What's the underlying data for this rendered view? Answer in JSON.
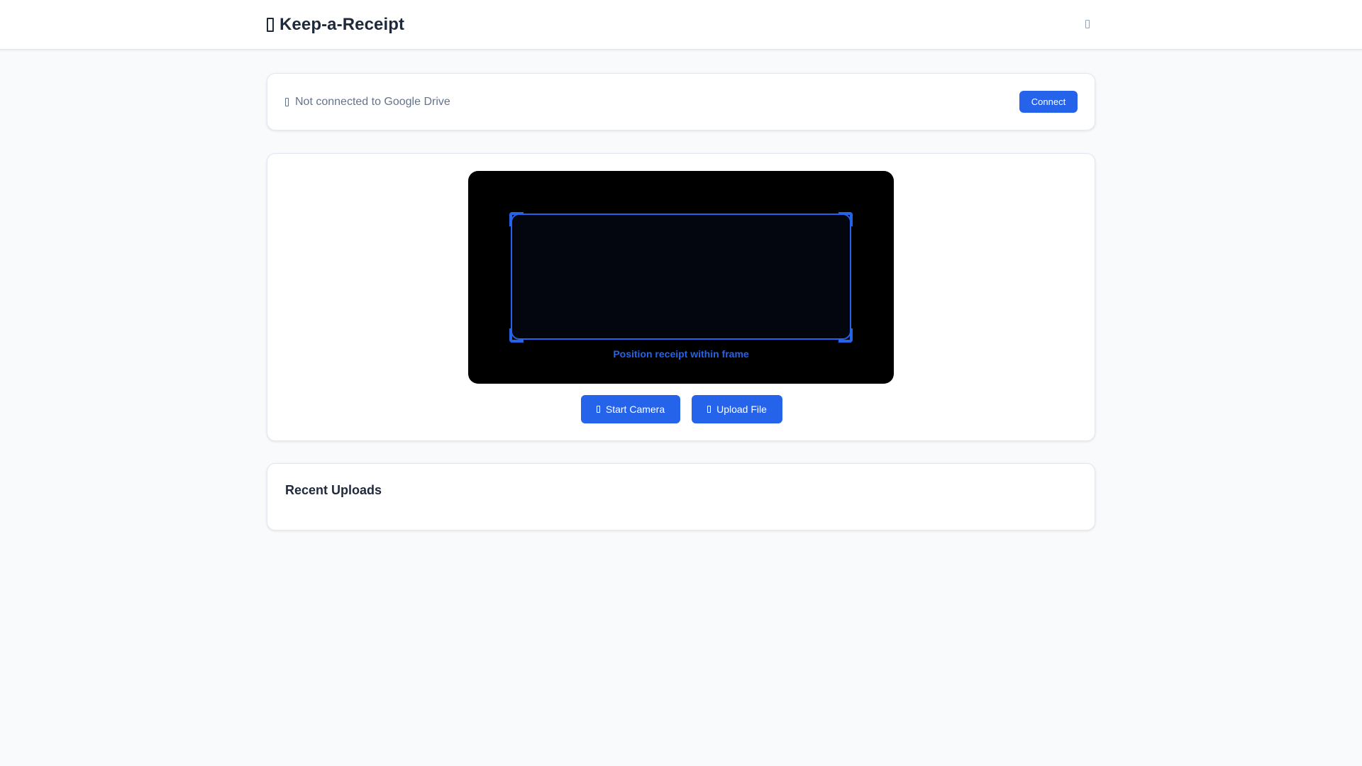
{
  "header": {
    "title": "Keep-a-Receipt",
    "brand_icon": "receipt-icon",
    "menu_icon": "menu-icon"
  },
  "drive": {
    "status_icon": "cloud-icon",
    "status_text": "Not connected to Google Drive",
    "connect_label": "Connect"
  },
  "scanner": {
    "frame_hint": "Position receipt within frame",
    "start_camera_label": "Start Camera",
    "start_camera_icon": "camera-icon",
    "upload_file_label": "Upload File",
    "upload_file_icon": "upload-icon"
  },
  "recent": {
    "title": "Recent Uploads",
    "items": []
  },
  "colors": {
    "accent": "#2563eb",
    "background": "#f8fafc",
    "card": "#ffffff",
    "text": "#1e293b",
    "muted": "#64748b",
    "viewport": "#000000"
  }
}
